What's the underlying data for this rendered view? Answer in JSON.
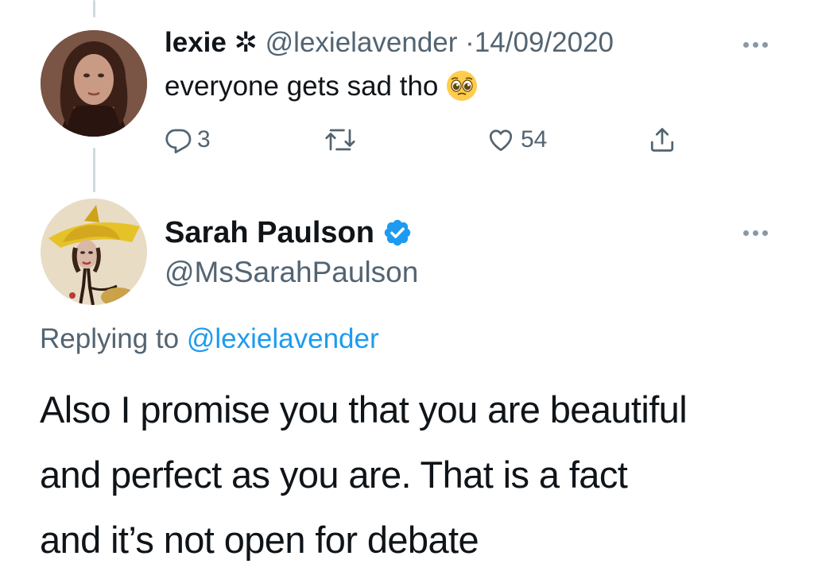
{
  "original_tweet": {
    "display_name": "lexie",
    "name_symbol": "✲",
    "handle": "@lexielavender",
    "separator": "·",
    "date": "14/09/2020",
    "text": "everyone gets sad tho",
    "emoji": "pleading-face-emoji",
    "actions": {
      "reply_count": "3",
      "retweet_count": "",
      "like_count": "54"
    },
    "avatar": "profile-photo"
  },
  "reply_tweet": {
    "display_name": "Sarah Paulson",
    "verified": true,
    "handle": "@MsSarahPaulson",
    "replying_prefix": "Replying to",
    "replying_to": "@lexielavender",
    "text_lines": [
      "Also I promise you that you are beautiful",
      "and perfect as you are. That is a fact",
      "and it’s not open for debate"
    ],
    "avatar": "illustrated-portrait"
  },
  "colors": {
    "primary_text": "#0f1419",
    "secondary_text": "#536471",
    "link_blue": "#1d9bf0",
    "verified_blue": "#1d9bf0",
    "thread_line": "#cfd9de"
  }
}
